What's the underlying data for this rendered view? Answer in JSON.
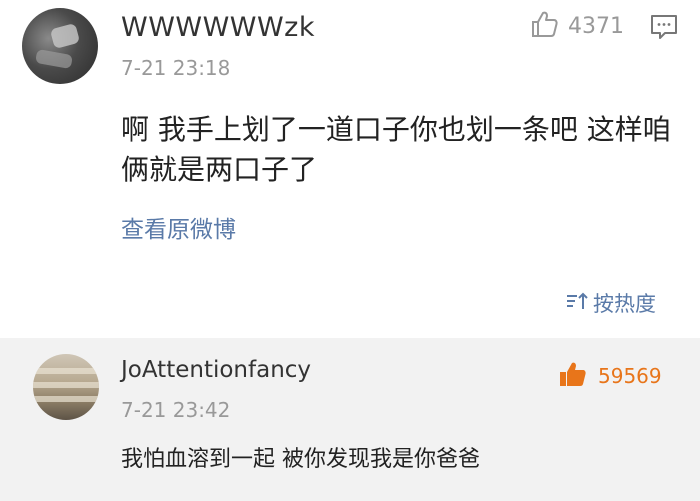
{
  "post": {
    "username": "WWWWWWzk",
    "time": "7-21 23:18",
    "like_count": "4371",
    "content": "啊 我手上划了一道口子你也划一条吧  这样咱俩就是两口子了",
    "view_original": "查看原微博",
    "sort_label": "按热度"
  },
  "reply": {
    "username": "JoAttentionfancy",
    "time": "7-21 23:42",
    "like_count": "59569",
    "content": "我怕血溶到一起 被你发现我是你爸爸"
  },
  "icons": {
    "like": "thumbs-up-icon",
    "comment": "comment-icon",
    "sort": "sort-icon"
  },
  "colors": {
    "link": "#5a7aa8",
    "liked": "#e8751a",
    "muted": "#999999",
    "reply_bg": "#f2f2f2"
  }
}
